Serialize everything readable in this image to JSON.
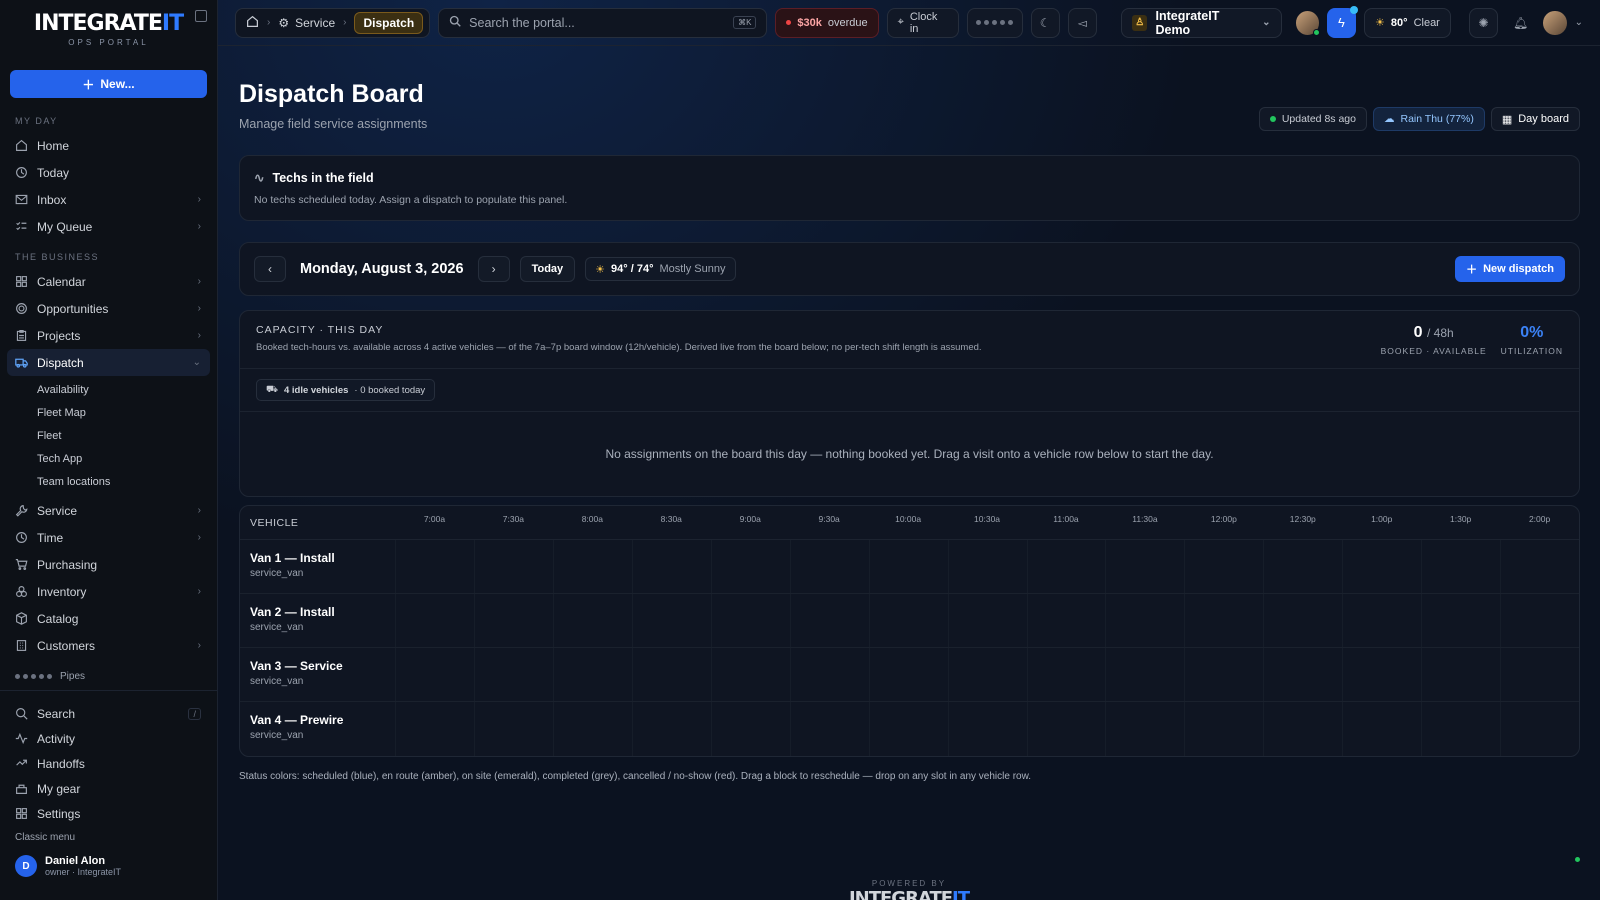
{
  "brand": {
    "name_a": "INTEGRATE",
    "name_b": "IT",
    "sub": "OPS PORTAL"
  },
  "sidebar": {
    "new_label": "New...",
    "section_my_day": "MY DAY",
    "my_day": [
      {
        "label": "Home",
        "icon": "home-icon",
        "chev": false
      },
      {
        "label": "Today",
        "icon": "clock-icon",
        "chev": false
      },
      {
        "label": "Inbox",
        "icon": "mail-icon",
        "chev": true
      },
      {
        "label": "My Queue",
        "icon": "list-check-icon",
        "chev": true
      }
    ],
    "section_business": "THE BUSINESS",
    "business": [
      {
        "label": "Calendar",
        "icon": "grid-icon",
        "chev": true
      },
      {
        "label": "Opportunities",
        "icon": "target-icon",
        "chev": true
      },
      {
        "label": "Projects",
        "icon": "clipboard-icon",
        "chev": true
      }
    ],
    "dispatch": {
      "label": "Dispatch",
      "children": [
        "Availability",
        "Fleet Map",
        "Fleet",
        "Tech App",
        "Team locations"
      ]
    },
    "business2": [
      {
        "label": "Service",
        "icon": "wrench-icon",
        "chev": true
      },
      {
        "label": "Time",
        "icon": "clock-icon",
        "chev": true
      },
      {
        "label": "Purchasing",
        "icon": "cart-icon",
        "chev": false
      },
      {
        "label": "Inventory",
        "icon": "boxes-icon",
        "chev": true
      },
      {
        "label": "Catalog",
        "icon": "package-icon",
        "chev": false
      },
      {
        "label": "Customers",
        "icon": "building-icon",
        "chev": true
      }
    ],
    "pipes": "Pipes",
    "bottom": [
      {
        "label": "Search",
        "icon": "search-icon",
        "kbd": "/"
      },
      {
        "label": "Activity",
        "icon": "activity-icon"
      },
      {
        "label": "Handoffs",
        "icon": "handoff-icon"
      },
      {
        "label": "My gear",
        "icon": "gear-bag-icon"
      },
      {
        "label": "Settings",
        "icon": "settings-grid-icon"
      }
    ],
    "classic": "Classic menu",
    "user": {
      "initial": "D",
      "name": "Daniel Alon",
      "role": "owner · IntegrateIT"
    }
  },
  "topbar": {
    "crumb_service": "Service",
    "crumb_current": "Dispatch",
    "search_placeholder": "Search the portal...",
    "search_kbd": "⌘K",
    "overdue_amount": "$30k",
    "overdue_label": "overdue",
    "clock_in": "Clock in",
    "org": "IntegrateIT Demo",
    "weather": "80°",
    "weather_label": "Clear"
  },
  "page": {
    "title": "Dispatch Board",
    "subtitle": "Manage field service assignments",
    "updated": "Updated 8s ago",
    "rain": "Rain Thu (77%)",
    "day_board": "Day board"
  },
  "techs": {
    "title": "Techs in the field",
    "desc": "No techs scheduled today. Assign a dispatch to populate this panel."
  },
  "datebar": {
    "date": "Monday, August 3, 2026",
    "today": "Today",
    "temps": "94° / 74°",
    "cond": "Mostly Sunny",
    "new_dispatch": "New dispatch"
  },
  "capacity": {
    "title": "CAPACITY · THIS DAY",
    "desc": "Booked tech-hours vs. available across 4 active vehicles — of the 7a–7p board window (12h/vehicle). Derived live from the board below; no per-tech shift length is assumed.",
    "booked": "0",
    "available": "/ 48h",
    "booked_label": "BOOKED · AVAILABLE",
    "util": "0%",
    "util_label": "UTILIZATION",
    "idle_b": "4 idle vehicles",
    "idle_rest": "· 0 booked today",
    "empty": "No assignments on the board this day — nothing booked yet. Drag a visit onto a vehicle row below to start the day."
  },
  "board": {
    "vehicle_header": "VEHICLE",
    "times": [
      "7:00a",
      "7:30a",
      "8:00a",
      "8:30a",
      "9:00a",
      "9:30a",
      "10:00a",
      "10:30a",
      "11:00a",
      "11:30a",
      "12:00p",
      "12:30p",
      "1:00p",
      "1:30p",
      "2:00p"
    ],
    "vehicles": [
      {
        "name": "Van 1 — Install",
        "type": "service_van"
      },
      {
        "name": "Van 2 — Install",
        "type": "service_van"
      },
      {
        "name": "Van 3 — Service",
        "type": "service_van"
      },
      {
        "name": "Van 4 — Prewire",
        "type": "service_van"
      }
    ]
  },
  "legend": "Status colors: scheduled (blue), en route (amber), on site (emerald), completed (grey), cancelled / no-show (red). Drag a block to reschedule — drop on any slot in any vehicle row.",
  "footer": {
    "powered": "POWERED BY",
    "name_a": "INTEGRATE",
    "name_b": "IT"
  },
  "colors": {
    "accent": "#2563eb",
    "online": "#22c55e",
    "overdue": "#ef4444"
  }
}
